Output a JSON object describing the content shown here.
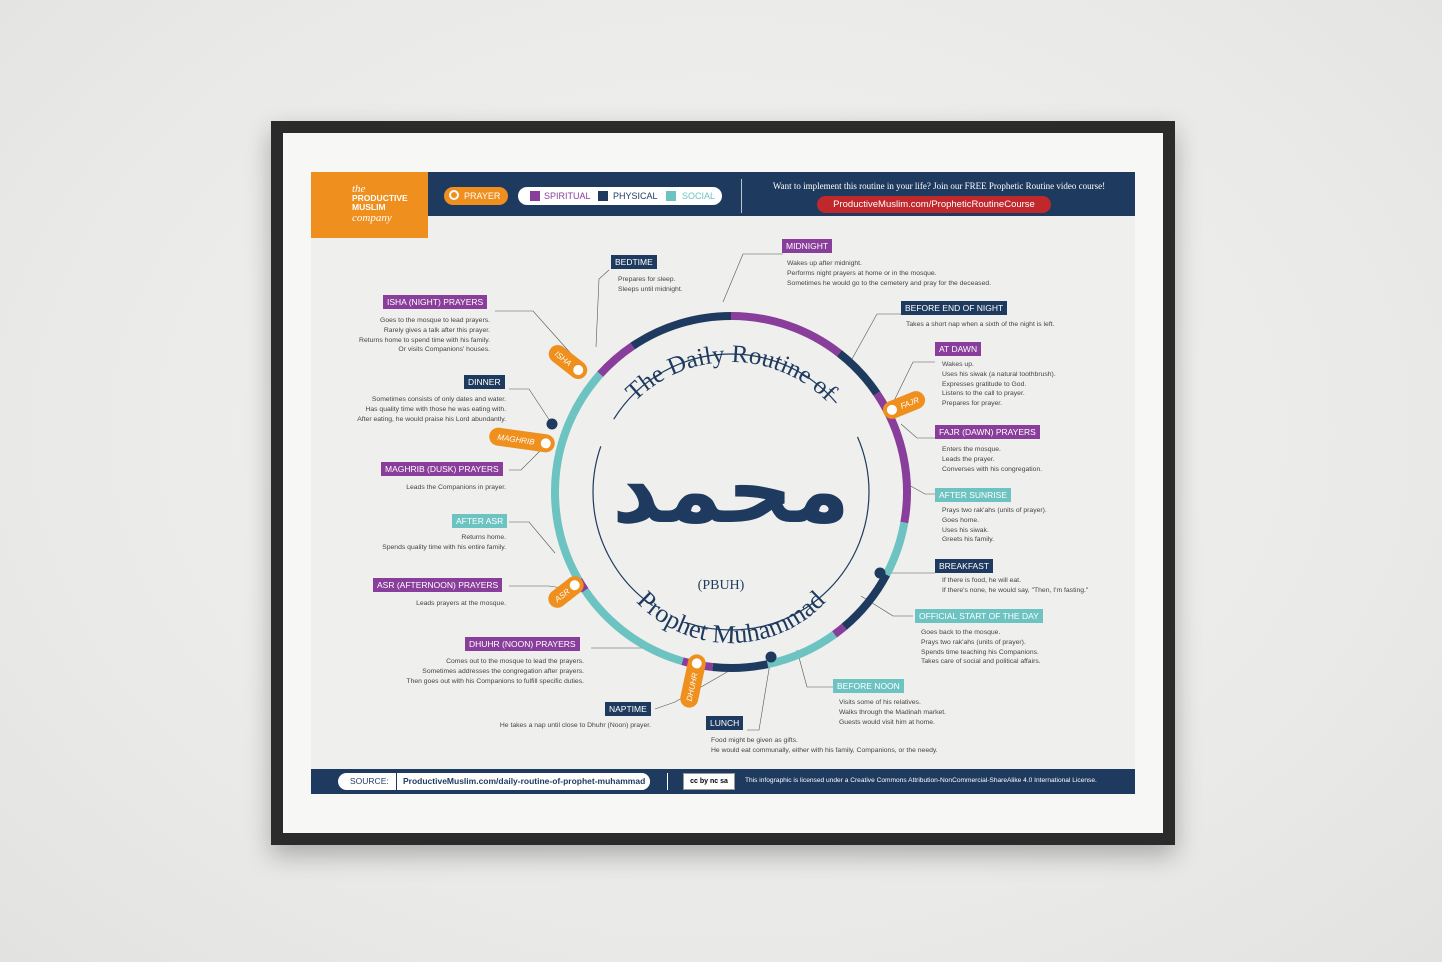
{
  "header": {
    "logo_line1": "the",
    "logo_line2": "PRODUCTIVE MUSLIM",
    "logo_line3": "company",
    "legend_prayer": "PRAYER",
    "legend_spiritual": "SPIRITUAL",
    "legend_physical": "PHYSICAL",
    "legend_social": "SOCIAL",
    "cta_text": "Want to implement this routine in your life? Join our FREE Prophetic Routine video course!",
    "cta_url": "ProductiveMuslim.com/PropheticRoutineCourse"
  },
  "colors": {
    "navy": "#1f3a5f",
    "purple": "#8a3e9b",
    "teal": "#6cc3c1",
    "orange": "#ef8f1d",
    "red": "#c0282b"
  },
  "center": {
    "arc_title": "The Daily Routine of",
    "arc_name": "Prophet Muhammad",
    "pbuh": "(PBUH)",
    "calligraphy": "محمد"
  },
  "prayer_tags": {
    "isha": "ISHA",
    "fajr": "FAJR",
    "maghrib": "MAGHRIB",
    "asr": "ASR",
    "dhuhr": "DHUHR"
  },
  "events": {
    "midnight": {
      "label": "MIDNIGHT",
      "desc": "Wakes up after midnight.\nPerforms night prayers at home or in the mosque.\nSometimes he would go to the cemetery and pray for the deceased."
    },
    "before_end_night": {
      "label": "BEFORE END OF NIGHT",
      "desc": "Takes a short nap when a sixth of the night is left."
    },
    "at_dawn": {
      "label": "AT DAWN",
      "desc": "Wakes up.\nUses his siwak (a natural toothbrush).\nExpresses gratitude to God.\nListens to the call to prayer.\nPrepares for prayer."
    },
    "fajr": {
      "label": "FAJR (DAWN) PRAYERS",
      "desc": "Enters the mosque.\nLeads the prayer.\nConverses with his congregation."
    },
    "after_sunrise": {
      "label": "AFTER SUNRISE",
      "desc": "Prays two rak'ahs (units of prayer).\nGoes home.\nUses his siwak.\nGreets his family."
    },
    "breakfast": {
      "label": "BREAKFAST",
      "desc": "If there is food, he will eat.\nIf there's none, he would say, \"Then, I'm fasting.\""
    },
    "official_start": {
      "label": "OFFICIAL START OF THE DAY",
      "desc": "Goes back to the mosque.\nPrays two rak'ahs (units of prayer).\nSpends time teaching his Companions.\nTakes care of social and political affairs."
    },
    "before_noon": {
      "label": "BEFORE NOON",
      "desc": "Visits some of his relatives.\nWalks through the Madinah market.\nGuests would visit him at home."
    },
    "lunch": {
      "label": "LUNCH",
      "desc": "Food might be given as gifts.\nHe would eat communally, either with his family, Companions, or the needy."
    },
    "naptime": {
      "label": "NAPTIME",
      "desc": "He takes a nap until close to Dhuhr (Noon) prayer."
    },
    "dhuhr": {
      "label": "DHUHR (NOON) PRAYERS",
      "desc": "Comes out to the mosque to lead the prayers.\nSometimes addresses the congregation after prayers.\nThen goes out with his Companions to fulfill specific duties."
    },
    "asr": {
      "label": "ASR (AFTERNOON) PRAYERS",
      "desc": "Leads prayers at the mosque."
    },
    "after_asr": {
      "label": "AFTER ASR",
      "desc": "Returns home.\nSpends quality time with his entire family."
    },
    "maghrib": {
      "label": "MAGHRIB (DUSK) PRAYERS",
      "desc": "Leads the Companions in prayer."
    },
    "dinner": {
      "label": "DINNER",
      "desc": "Sometimes consists of only dates and water.\nHas quality time with those he was eating with.\nAfter eating, he would praise his Lord abundantly."
    },
    "isha": {
      "label": "ISHA (NIGHT) PRAYERS",
      "desc": "Goes to the mosque to lead prayers.\nRarely gives a talk after this prayer.\nReturns home to spend time with his family.\nOr visits Companions' houses."
    },
    "bedtime": {
      "label": "BEDTIME",
      "desc": "Prepares for sleep.\nSleeps until midnight."
    }
  },
  "footer": {
    "source_label": "SOURCE:",
    "source_url": "ProductiveMuslim.com/daily-routine-of-prophet-muhammad",
    "cc_badge": "cc by nc sa",
    "license": "This infographic is licensed under a Creative Commons Attribution-NonCommercial-ShareAlike 4.0 International License."
  }
}
